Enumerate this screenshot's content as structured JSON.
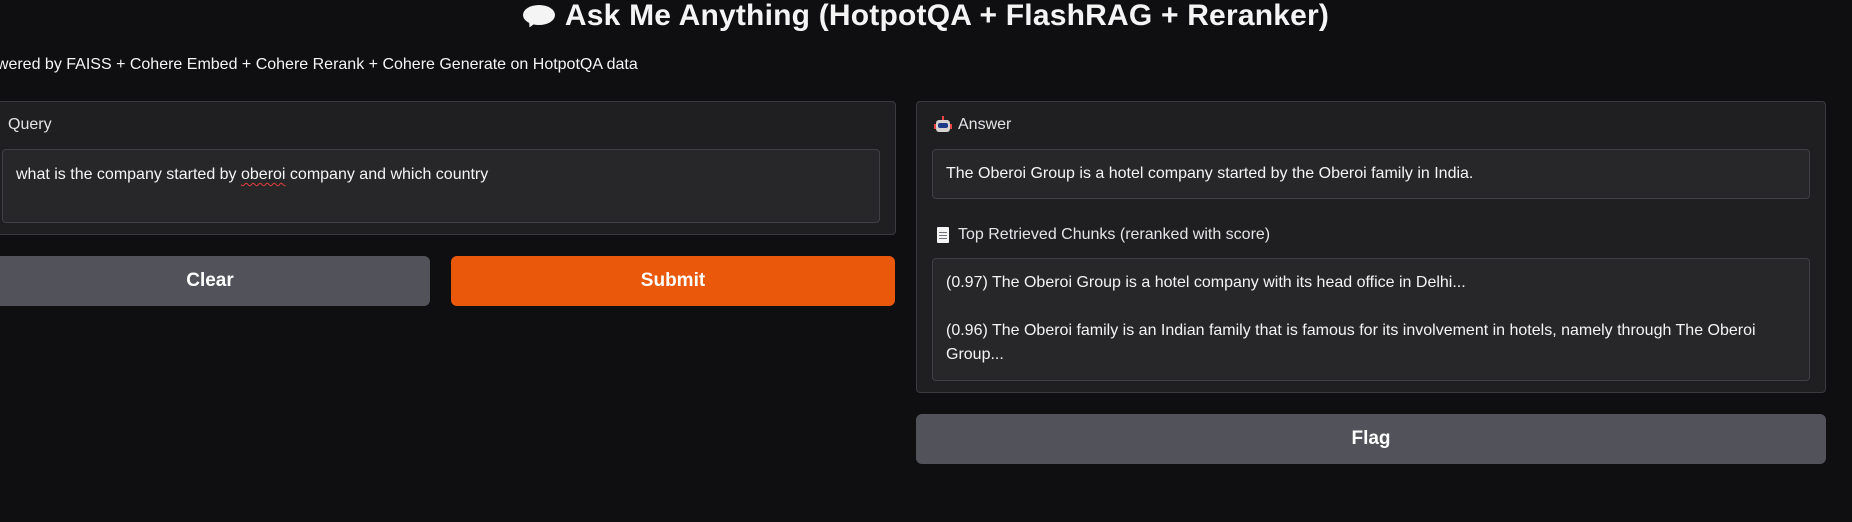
{
  "header": {
    "title": "Ask Me Anything (HotpotQA + FlashRAG + Reranker)",
    "title_icon": "speech-bubble-icon",
    "subtitle": "owered by FAISS + Cohere Embed + Cohere Rerank + Cohere Generate on HotpotQA data"
  },
  "query": {
    "label": "Query",
    "value_before": "what is the company started by ",
    "value_misspelled": "oberoi",
    "value_after": " company and which country"
  },
  "buttons": {
    "clear": "Clear",
    "submit": "Submit",
    "flag": "Flag"
  },
  "answer": {
    "label": "Answer",
    "icon": "robot-icon",
    "value": "The Oberoi Group is a hotel company started by the Oberoi family in India."
  },
  "chunks": {
    "label": "Top Retrieved Chunks (reranked with score)",
    "icon": "document-icon",
    "items": [
      "(0.97) The Oberoi Group is a hotel company with its head office in Delhi...",
      "(0.96) The Oberoi family is an Indian family that is famous for its involvement in hotels, namely through The Oberoi Group..."
    ]
  },
  "colors": {
    "background": "#0f0f11",
    "panel": "#1f1f22",
    "field": "#27272a",
    "primary_button": "#ea580c",
    "secondary_button": "#52525b"
  }
}
